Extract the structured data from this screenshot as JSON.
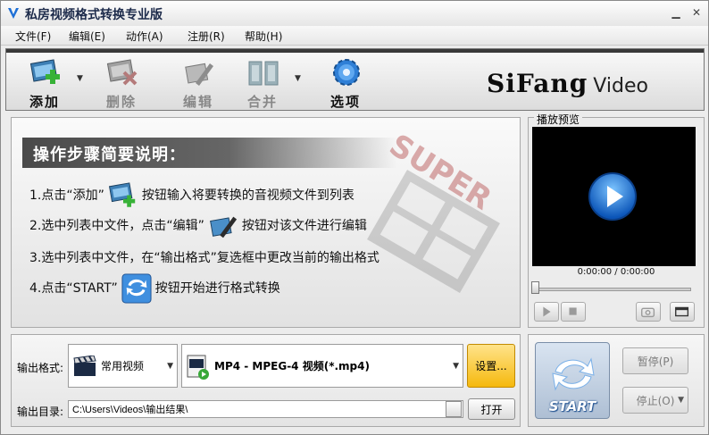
{
  "window": {
    "title": "私房视频格式转换专业版"
  },
  "menu": [
    "文件(F)",
    "编辑(E)",
    "动作(A)",
    "注册(R)",
    "帮助(H)"
  ],
  "toolbar": {
    "add": "添加",
    "delete": "删除",
    "edit": "编辑",
    "merge": "合并",
    "options": "选项"
  },
  "brand": {
    "name": "SiFang",
    "suffix": "Video"
  },
  "steps": {
    "title": "操作步骤简要说明：",
    "s1a": "1.点击“添加”",
    "s1b": "按钮输入将要转换的音视频文件到列表",
    "s2a": "2.选中列表中文件，点击“编辑”",
    "s2b": "按钮对该文件进行编辑",
    "s3": "3.选中列表中文件，在“输出格式”复选框中更改当前的输出格式",
    "s4a": "4.点击“START”",
    "s4b": "按钮开始进行格式转换"
  },
  "preview": {
    "label": "播放预览",
    "time": "0:00:00 / 0:00:00",
    "seek_position": 0
  },
  "output": {
    "format_label": "输出格式:",
    "category": "常用视频",
    "format": "MP4 - MPEG-4 视频(*.mp4)",
    "settings": "设置...",
    "dir_label": "输出目录:",
    "dir_value": "C:\\Users\\Videos\\输出结果\\",
    "open": "打开"
  },
  "controls": {
    "start": "START",
    "pause": "暂停(P)",
    "stop": "停止(O)"
  },
  "watermark": "SUPER",
  "colors": {
    "accent_blue": "#1d6fd6",
    "settings_yellow": "#f5b90e",
    "toolbar_dark": "#3a3a3a"
  }
}
